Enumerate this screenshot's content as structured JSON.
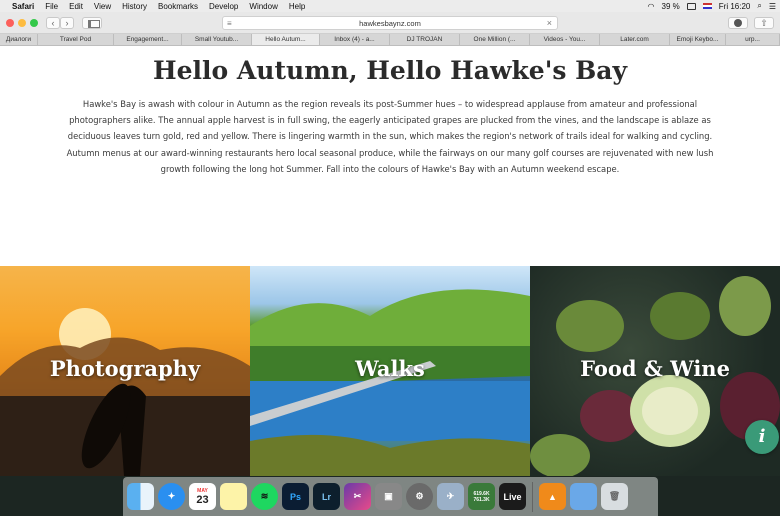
{
  "menubar": {
    "app": "Safari",
    "items": [
      "File",
      "Edit",
      "View",
      "History",
      "Bookmarks",
      "Develop",
      "Window",
      "Help"
    ],
    "battery": "39 %",
    "clock": "Fri 16:20"
  },
  "toolbar": {
    "url": "hawkesbaynz.com",
    "back_glyph": "‹",
    "forward_glyph": "›"
  },
  "tabs": [
    {
      "label": "Диалоги"
    },
    {
      "label": "Travel Pod"
    },
    {
      "label": "Engagement..."
    },
    {
      "label": "Small Youtub..."
    },
    {
      "label": "Hello Autum..."
    },
    {
      "label": "Inbox (4) - a..."
    },
    {
      "label": "DJ TROJAN"
    },
    {
      "label": "One Million (..."
    },
    {
      "label": "Videos - You..."
    },
    {
      "label": "Later.com"
    },
    {
      "label": "Emoji Keybo..."
    },
    {
      "label": "urp..."
    }
  ],
  "page": {
    "headline": "Hello Autumn, Hello Hawke's Bay",
    "intro": "Hawke's Bay is awash with colour in Autumn as the region reveals its post-Summer hues – to widespread applause from amateur and professional photographers alike. The annual apple harvest is in full swing, the eagerly anticipated grapes are plucked from the vines, and the landscape is ablaze as deciduous leaves turn gold, red and yellow. There is lingering warmth in the sun, which makes the region's network of trails ideal for walking and cycling. Autumn menus at our award-winning restaurants hero local seasonal produce, while the fairways on our many golf courses are rejuvenated with new lush growth following the long hot Summer. Fall into the colours of Hawke's Bay with an Autumn weekend escape.",
    "tiles": [
      {
        "label": "Photography"
      },
      {
        "label": "Walks"
      },
      {
        "label": "Food & Wine"
      }
    ],
    "info_button": "i"
  },
  "dock": {
    "calendar_day": "23",
    "calendar_month": "MAY",
    "ps": "Ps",
    "lr": "Lr",
    "live": "Live",
    "net_up": "619.6K",
    "net_down": "761.3K"
  }
}
